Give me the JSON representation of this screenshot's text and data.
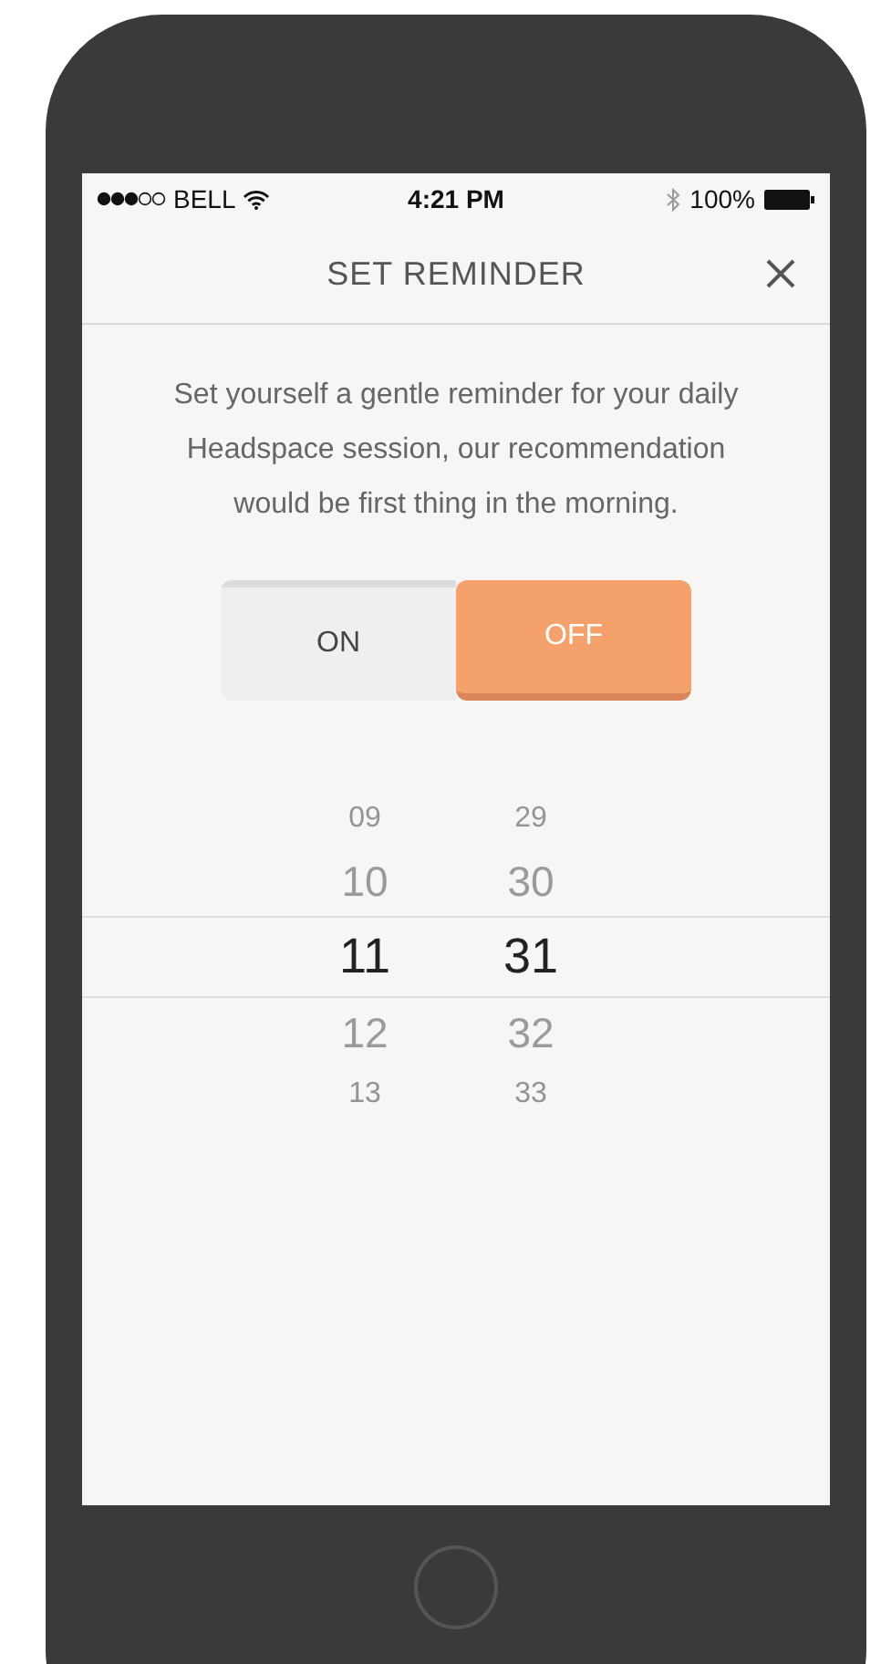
{
  "status_bar": {
    "carrier": "BELL",
    "time": "4:21 PM",
    "battery": "100%"
  },
  "header": {
    "title": "SET REMINDER"
  },
  "description": "Set yourself a gentle reminder for your daily Headspace session, our recommendation would be first thing in the morning.",
  "toggle": [
    {
      "label": "ON",
      "selected": false
    },
    {
      "label": "OFF",
      "selected": true
    }
  ],
  "picker": [
    {
      "hour": "09",
      "minute": "29",
      "selected": false
    },
    {
      "hour": "10",
      "minute": "30",
      "selected": false
    },
    {
      "hour": "11",
      "minute": "31",
      "selected": true
    },
    {
      "hour": "12",
      "minute": "32",
      "selected": false
    },
    {
      "hour": "13",
      "minute": "33",
      "selected": false
    }
  ]
}
